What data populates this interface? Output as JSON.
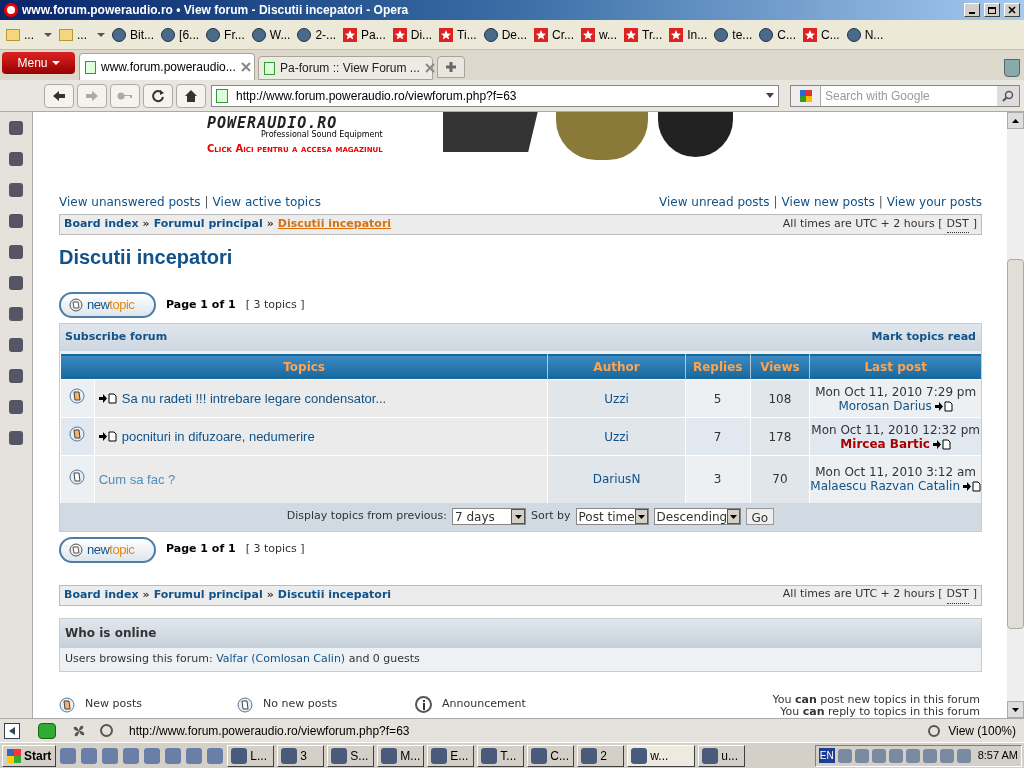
{
  "window": {
    "title": "www.forum.poweraudio.ro • View forum - Discutii incepatori - Opera"
  },
  "bookmarks": [
    {
      "label": "...",
      "kind": "folder"
    },
    {
      "label": "...",
      "kind": "folder"
    },
    {
      "label": "Bit...",
      "kind": "site"
    },
    {
      "label": "[6...",
      "kind": "site"
    },
    {
      "label": "Fr...",
      "kind": "site"
    },
    {
      "label": "W...",
      "kind": "site"
    },
    {
      "label": "2-...",
      "kind": "site"
    },
    {
      "label": "Pa...",
      "kind": "star"
    },
    {
      "label": "Di...",
      "kind": "star"
    },
    {
      "label": "Ti...",
      "kind": "star"
    },
    {
      "label": "De...",
      "kind": "site"
    },
    {
      "label": "Cr...",
      "kind": "star"
    },
    {
      "label": "w...",
      "kind": "star"
    },
    {
      "label": "Tr...",
      "kind": "star"
    },
    {
      "label": "In...",
      "kind": "star"
    },
    {
      "label": "te...",
      "kind": "site"
    },
    {
      "label": "C...",
      "kind": "site"
    },
    {
      "label": "C...",
      "kind": "star"
    },
    {
      "label": "N...",
      "kind": "site"
    }
  ],
  "menu_button": "Menu",
  "tabs": [
    {
      "label": "www.forum.poweraudio...",
      "selected": true
    },
    {
      "label": "Pa-forum :: View Forum ...",
      "selected": false
    }
  ],
  "address": {
    "url": "http://www.forum.poweraudio.ro/viewforum.php?f=63",
    "search_placeholder": "Search with Google"
  },
  "banner": {
    "logo": "POWERAUDIO.RO",
    "tagline": "Professional Sound Equipment",
    "cta": "Click Aici pentru a accesa magazinul"
  },
  "link_separator": "|",
  "breadcrumb_separator": "»",
  "links_left": [
    "View unanswered posts",
    "View active topics"
  ],
  "links_right": [
    "View unread posts",
    "View new posts",
    "View your posts"
  ],
  "breadcrumb_top": [
    {
      "label": "Board index",
      "current": false
    },
    {
      "label": "Forumul principal",
      "current": false
    },
    {
      "label": "Discutii incepatori",
      "current": true
    }
  ],
  "timezone_top": [
    "All times are UTC + 2 hours [",
    "DST",
    "]"
  ],
  "forum_title": "Discutii incepatori",
  "pagination_top": {
    "button": [
      "new",
      "topic"
    ],
    "page": "Page 1 of 1",
    "count": "[ 3 topics ]"
  },
  "forum_actions": [
    "Subscribe forum",
    "Mark topics read"
  ],
  "columns": [
    "Topics",
    "Author",
    "Replies",
    "Views",
    "Last post"
  ],
  "rows": [
    {
      "title": "Sa nu radeti !!! intrebare legare condensator...",
      "unread": true,
      "author": "Uzzi",
      "replies": "5",
      "views": "108",
      "last_time": "Mon Oct 11, 2010 7:29 pm",
      "last_author": {
        "name": "Morosan Darius",
        "color": "#105289"
      }
    },
    {
      "title": "pocnituri in difuzoare, nedumerire",
      "unread": true,
      "author": "Uzzi",
      "replies": "7",
      "views": "178",
      "last_time": "Mon Oct 11, 2010 12:32 pm",
      "last_author": {
        "name": "Mircea Bartic",
        "color": "#aa0000"
      }
    },
    {
      "title": "Cum sa fac ?",
      "unread": false,
      "author": "DariusN",
      "replies": "3",
      "views": "70",
      "last_time": "Mon Oct 11, 2010 3:12 am",
      "last_author": {
        "name": "Malaescu Razvan Catalin",
        "color": "#105289"
      }
    }
  ],
  "filter": {
    "label": "Display topics from previous:",
    "days": "7 days",
    "sort_label": "Sort by",
    "sort": "Post time",
    "order": "Descending",
    "go": "Go"
  },
  "pagination_bottom": {
    "button": [
      "new",
      "topic"
    ],
    "page": "Page 1 of 1",
    "count": "[ 3 topics ]"
  },
  "breadcrumb_bottom": [
    {
      "label": "Board index",
      "current": false
    },
    {
      "label": "Forumul principal",
      "current": false
    },
    {
      "label": "Discutii incepatori",
      "current": false
    }
  ],
  "timezone_bottom": [
    "All times are UTC + 2 hours [",
    "DST",
    "]"
  ],
  "who_is_online": {
    "title": "Who is online",
    "prefix": "Users browsing this forum:",
    "user": "Valfar (Comlosan Calin)",
    "suffix": "and 0 guests"
  },
  "legend": [
    {
      "label": "New posts",
      "kind": "new"
    },
    {
      "label": "No new posts",
      "kind": "read"
    },
    {
      "label": "Announcement",
      "kind": "announce"
    }
  ],
  "permissions": [
    "You **can** post new topics in this forum",
    "You **can** reply to topics in this forum"
  ],
  "status_bar": {
    "url": "http://www.forum.poweraudio.ro/viewforum.php?f=63",
    "zoom": "View (100%)"
  },
  "taskbar": {
    "start": "Start",
    "buttons": [
      "L...",
      "3",
      "S...",
      "M...",
      "E...",
      "T...",
      "C...",
      "2",
      "w...",
      "u..."
    ],
    "language": "EN",
    "clock": "8:57 AM"
  }
}
